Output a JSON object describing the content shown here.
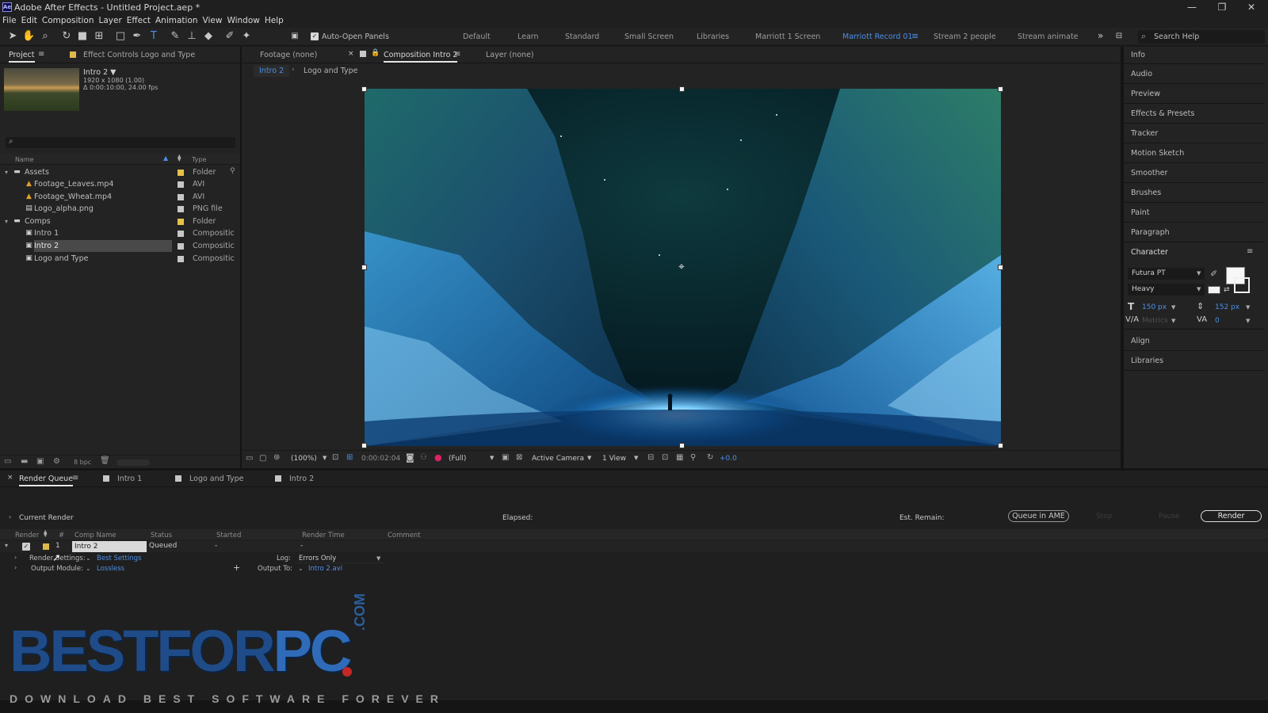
{
  "window": {
    "title": "Adobe After Effects - Untitled Project.aep *",
    "app_icon": "Ae",
    "minimize": "—",
    "maximize": "❐",
    "close": "✕"
  },
  "menu": [
    "File",
    "Edit",
    "Composition",
    "Layer",
    "Effect",
    "Animation",
    "View",
    "Window",
    "Help"
  ],
  "toolbar": {
    "auto_open_label": "Auto-Open Panels",
    "workspaces": [
      "Default",
      "Learn",
      "Standard",
      "Small Screen",
      "Libraries",
      "Marriott 1 Screen",
      "Marriott Record 01",
      "Stream 2 people",
      "Stream animate"
    ],
    "active_workspace": "Marriott Record 01",
    "overflow": "»",
    "search_placeholder": "Search Help"
  },
  "project_panel": {
    "tab": "Project",
    "effect_controls_tab": "Effect Controls Logo and Type",
    "selected_name": "Intro 2 ▼",
    "selected_info_1": "1920 x 1080 (1.00)",
    "selected_info_2": "Δ 0:00:10:00, 24.00 fps",
    "search_placeholder": "",
    "col_name": "Name",
    "col_type": "Type",
    "items": [
      {
        "name": "Assets",
        "type": "Folder",
        "kind": "folder"
      },
      {
        "name": "Footage_Leaves.mp4",
        "type": "AVI",
        "kind": "footage"
      },
      {
        "name": "Footage_Wheat.mp4",
        "type": "AVI",
        "kind": "footage"
      },
      {
        "name": "Logo_alpha.png",
        "type": "PNG file",
        "kind": "file"
      },
      {
        "name": "Comps",
        "type": "Folder",
        "kind": "folder"
      },
      {
        "name": "Intro 1",
        "type": "Compositic",
        "kind": "comp"
      },
      {
        "name": "Intro 2",
        "type": "Compositic",
        "kind": "comp"
      },
      {
        "name": "Logo and Type",
        "type": "Compositic",
        "kind": "comp"
      }
    ],
    "bit_depth": "8 bpc"
  },
  "viewer": {
    "footage_tab": "Footage (none)",
    "comp_tab": "Composition Intro 2",
    "layer_tab": "Layer (none)",
    "breadcrumb_active": "Intro 2",
    "breadcrumb_next": "Logo and Type",
    "zoom": "(100%)",
    "timecode": "0:00:02:04",
    "resolution": "(Full)",
    "camera": "Active Camera",
    "views": "1 View",
    "exposure": "+0.0"
  },
  "right_panel": {
    "items": [
      "Info",
      "Audio",
      "Preview",
      "Effects & Presets",
      "Tracker",
      "Motion Sketch",
      "Smoother",
      "Brushes",
      "Paint",
      "Paragraph"
    ],
    "character_title": "Character",
    "font_family": "Futura PT",
    "font_style": "Heavy",
    "font_size": "150 px",
    "leading": "152 px",
    "kerning": "Metrics",
    "tracking": "0",
    "after_items": [
      "Align",
      "Libraries"
    ]
  },
  "render_queue": {
    "tabs": [
      "Render Queue",
      "Intro 1",
      "Logo and Type",
      "Intro 2"
    ],
    "current_render": "Current Render",
    "elapsed": "Elapsed:",
    "est_remain": "Est. Remain:",
    "queue_ame": "Queue in AME",
    "stop": "Stop",
    "pause": "Pause",
    "render": "Render",
    "columns": [
      "Render",
      "#",
      "Comp Name",
      "Status",
      "Started",
      "Render Time",
      "Comment"
    ],
    "row": {
      "index": "1",
      "comp": "Intro 2",
      "status": "Queued",
      "started": "-",
      "render_time": "-"
    },
    "render_settings_label": "Render Settings:",
    "render_settings_value": "Best Settings",
    "log_label": "Log:",
    "log_value": "Errors Only",
    "output_module_label": "Output Module:",
    "output_module_value": "Lossless",
    "output_to_label": "Output To:",
    "output_to_value": "Intro 2.avi"
  },
  "watermark": {
    "brand_a": "BESTFOR",
    "brand_b": "PC",
    "com": ".COM",
    "tagline": "DOWNLOAD BEST SOFTWARE FOREVER"
  }
}
